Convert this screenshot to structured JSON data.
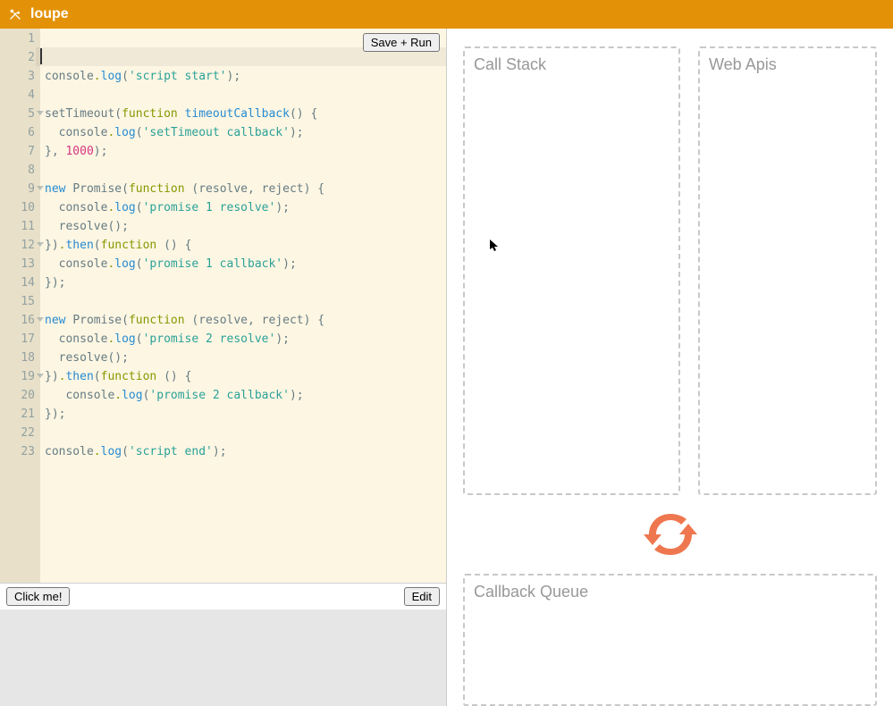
{
  "header": {
    "title": "loupe"
  },
  "editor": {
    "save_run_label": "Save + Run",
    "line_count": 23,
    "fold_lines": [
      5,
      9,
      12,
      16,
      19
    ],
    "active_line": 2,
    "lines": [
      [],
      [],
      [
        {
          "c": "tok-console",
          "t": "console"
        },
        {
          "c": "tok-dot",
          "t": "."
        },
        {
          "c": "tok-log",
          "t": "log"
        },
        {
          "c": "tok-paren",
          "t": "("
        },
        {
          "c": "tok-str",
          "t": "'script start'"
        },
        {
          "c": "tok-paren",
          "t": ")"
        },
        {
          "c": "tok-default",
          "t": ";"
        }
      ],
      [],
      [
        {
          "c": "tok-console",
          "t": "setTimeout"
        },
        {
          "c": "tok-paren",
          "t": "("
        },
        {
          "c": "tok-kw",
          "t": "function"
        },
        {
          "c": "tok-default",
          "t": " "
        },
        {
          "c": "tok-fn",
          "t": "timeoutCallback"
        },
        {
          "c": "tok-paren",
          "t": "()"
        },
        {
          "c": "tok-default",
          "t": " "
        },
        {
          "c": "tok-paren",
          "t": "{"
        }
      ],
      [
        {
          "c": "tok-default",
          "t": "  "
        },
        {
          "c": "tok-console",
          "t": "console"
        },
        {
          "c": "tok-dot",
          "t": "."
        },
        {
          "c": "tok-log",
          "t": "log"
        },
        {
          "c": "tok-paren",
          "t": "("
        },
        {
          "c": "tok-str",
          "t": "'setTimeout callback'"
        },
        {
          "c": "tok-paren",
          "t": ")"
        },
        {
          "c": "tok-default",
          "t": ";"
        }
      ],
      [
        {
          "c": "tok-paren",
          "t": "}"
        },
        {
          "c": "tok-default",
          "t": ", "
        },
        {
          "c": "tok-num",
          "t": "1000"
        },
        {
          "c": "tok-paren",
          "t": ")"
        },
        {
          "c": "tok-default",
          "t": ";"
        }
      ],
      [],
      [
        {
          "c": "tok-new",
          "t": "new"
        },
        {
          "c": "tok-default",
          "t": " "
        },
        {
          "c": "tok-console",
          "t": "Promise"
        },
        {
          "c": "tok-paren",
          "t": "("
        },
        {
          "c": "tok-kw",
          "t": "function"
        },
        {
          "c": "tok-default",
          "t": " "
        },
        {
          "c": "tok-paren",
          "t": "("
        },
        {
          "c": "tok-default",
          "t": "resolve, reject"
        },
        {
          "c": "tok-paren",
          "t": ")"
        },
        {
          "c": "tok-default",
          "t": " "
        },
        {
          "c": "tok-paren",
          "t": "{"
        }
      ],
      [
        {
          "c": "tok-default",
          "t": "  "
        },
        {
          "c": "tok-console",
          "t": "console"
        },
        {
          "c": "tok-dot",
          "t": "."
        },
        {
          "c": "tok-log",
          "t": "log"
        },
        {
          "c": "tok-paren",
          "t": "("
        },
        {
          "c": "tok-str",
          "t": "'promise 1 resolve'"
        },
        {
          "c": "tok-paren",
          "t": ")"
        },
        {
          "c": "tok-default",
          "t": ";"
        }
      ],
      [
        {
          "c": "tok-default",
          "t": "  "
        },
        {
          "c": "tok-console",
          "t": "resolve"
        },
        {
          "c": "tok-paren",
          "t": "()"
        },
        {
          "c": "tok-default",
          "t": ";"
        }
      ],
      [
        {
          "c": "tok-paren",
          "t": "})"
        },
        {
          "c": "tok-dot",
          "t": "."
        },
        {
          "c": "tok-log",
          "t": "then"
        },
        {
          "c": "tok-paren",
          "t": "("
        },
        {
          "c": "tok-kw",
          "t": "function"
        },
        {
          "c": "tok-default",
          "t": " "
        },
        {
          "c": "tok-paren",
          "t": "()"
        },
        {
          "c": "tok-default",
          "t": " "
        },
        {
          "c": "tok-paren",
          "t": "{"
        }
      ],
      [
        {
          "c": "tok-default",
          "t": "  "
        },
        {
          "c": "tok-console",
          "t": "console"
        },
        {
          "c": "tok-dot",
          "t": "."
        },
        {
          "c": "tok-log",
          "t": "log"
        },
        {
          "c": "tok-paren",
          "t": "("
        },
        {
          "c": "tok-str",
          "t": "'promise 1 callback'"
        },
        {
          "c": "tok-paren",
          "t": ")"
        },
        {
          "c": "tok-default",
          "t": ";"
        }
      ],
      [
        {
          "c": "tok-paren",
          "t": "})"
        },
        {
          "c": "tok-default",
          "t": ";"
        }
      ],
      [],
      [
        {
          "c": "tok-new",
          "t": "new"
        },
        {
          "c": "tok-default",
          "t": " "
        },
        {
          "c": "tok-console",
          "t": "Promise"
        },
        {
          "c": "tok-paren",
          "t": "("
        },
        {
          "c": "tok-kw",
          "t": "function"
        },
        {
          "c": "tok-default",
          "t": " "
        },
        {
          "c": "tok-paren",
          "t": "("
        },
        {
          "c": "tok-default",
          "t": "resolve, reject"
        },
        {
          "c": "tok-paren",
          "t": ")"
        },
        {
          "c": "tok-default",
          "t": " "
        },
        {
          "c": "tok-paren",
          "t": "{"
        }
      ],
      [
        {
          "c": "tok-default",
          "t": "  "
        },
        {
          "c": "tok-console",
          "t": "console"
        },
        {
          "c": "tok-dot",
          "t": "."
        },
        {
          "c": "tok-log",
          "t": "log"
        },
        {
          "c": "tok-paren",
          "t": "("
        },
        {
          "c": "tok-str",
          "t": "'promise 2 resolve'"
        },
        {
          "c": "tok-paren",
          "t": ")"
        },
        {
          "c": "tok-default",
          "t": ";"
        }
      ],
      [
        {
          "c": "tok-default",
          "t": "  "
        },
        {
          "c": "tok-console",
          "t": "resolve"
        },
        {
          "c": "tok-paren",
          "t": "()"
        },
        {
          "c": "tok-default",
          "t": ";"
        }
      ],
      [
        {
          "c": "tok-paren",
          "t": "})"
        },
        {
          "c": "tok-dot",
          "t": "."
        },
        {
          "c": "tok-log",
          "t": "then"
        },
        {
          "c": "tok-paren",
          "t": "("
        },
        {
          "c": "tok-kw",
          "t": "function"
        },
        {
          "c": "tok-default",
          "t": " "
        },
        {
          "c": "tok-paren",
          "t": "()"
        },
        {
          "c": "tok-default",
          "t": " "
        },
        {
          "c": "tok-paren",
          "t": "{"
        }
      ],
      [
        {
          "c": "tok-default",
          "t": "   "
        },
        {
          "c": "tok-console",
          "t": "console"
        },
        {
          "c": "tok-dot",
          "t": "."
        },
        {
          "c": "tok-log",
          "t": "log"
        },
        {
          "c": "tok-paren",
          "t": "("
        },
        {
          "c": "tok-str",
          "t": "'promise 2 callback'"
        },
        {
          "c": "tok-paren",
          "t": ")"
        },
        {
          "c": "tok-default",
          "t": ";"
        }
      ],
      [
        {
          "c": "tok-paren",
          "t": "})"
        },
        {
          "c": "tok-default",
          "t": ";"
        }
      ],
      [],
      [
        {
          "c": "tok-console",
          "t": "console"
        },
        {
          "c": "tok-dot",
          "t": "."
        },
        {
          "c": "tok-log",
          "t": "log"
        },
        {
          "c": "tok-paren",
          "t": "("
        },
        {
          "c": "tok-str",
          "t": "'script end'"
        },
        {
          "c": "tok-paren",
          "t": ")"
        },
        {
          "c": "tok-default",
          "t": ";"
        }
      ]
    ]
  },
  "controls": {
    "click_me_label": "Click me!",
    "edit_label": "Edit"
  },
  "panels": {
    "call_stack_title": "Call Stack",
    "web_apis_title": "Web Apis",
    "callback_queue_title": "Callback Queue"
  }
}
